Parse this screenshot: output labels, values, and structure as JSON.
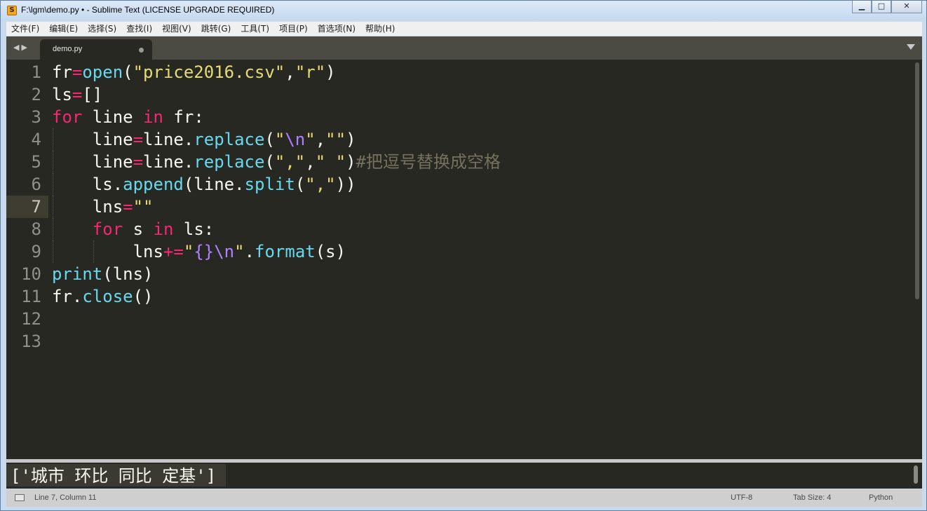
{
  "window": {
    "title": "F:\\lgm\\demo.py • - Sublime Text (LICENSE UPGRADE REQUIRED)",
    "controls": {
      "minimize": "▁",
      "maximize": "□",
      "close": "✕"
    }
  },
  "menu": [
    "文件(F)",
    "编辑(E)",
    "选择(S)",
    "查找(I)",
    "视图(V)",
    "跳转(G)",
    "工具(T)",
    "项目(P)",
    "首选项(N)",
    "帮助(H)"
  ],
  "tabs": [
    {
      "label": "demo.py",
      "modified": true
    }
  ],
  "editor": {
    "active_line": 7,
    "line_numbers": [
      "1",
      "2",
      "3",
      "4",
      "5",
      "6",
      "7",
      "8",
      "9",
      "10",
      "11",
      "12",
      "13"
    ]
  },
  "output_panel": {
    "text": "['城市 环比 同比 定基']"
  },
  "status_bar": {
    "position": "Line 7, Column 11",
    "encoding": "UTF-8",
    "tab_size": "Tab Size: 4",
    "syntax": "Python"
  },
  "theme_colors": {
    "editor_bg": "#272822",
    "keyword": "#f92672",
    "function": "#66d9ef",
    "string": "#e6db74",
    "escape": "#ae81ff",
    "comment": "#75715e"
  }
}
